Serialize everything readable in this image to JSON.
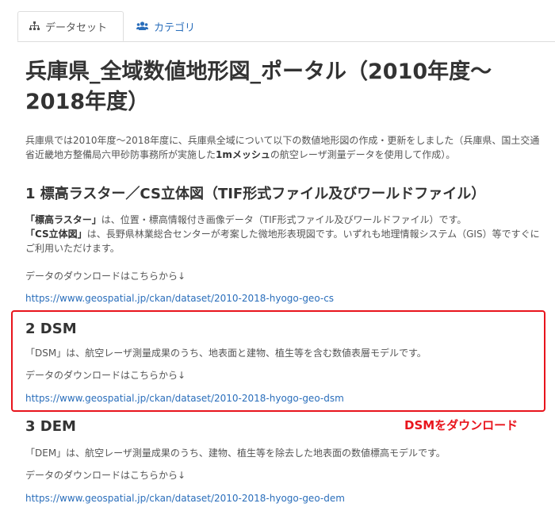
{
  "tabs": {
    "dataset": "データセット",
    "category": "カテゴリ"
  },
  "title": "兵庫県_全域数値地形図_ポータル（2010年度～2018年度）",
  "intro": {
    "text_before": "兵庫県では2010年度～2018年度に、兵庫県全域について以下の数値地形図の作成・更新をしました（兵庫県、国土交通省近畿地方整備局六甲砂防事務所が実施した",
    "bold": "1mメッシュ",
    "text_after": "の航空レーザ測量データを使用して作成）。"
  },
  "section1": {
    "heading": "1 標高ラスター／CS立体図（TIF形式ファイル及びワールドファイル）",
    "line1_bold": "「標高ラスター」",
    "line1_text": "は、位置・標高情報付き画像データ（TIF形式ファイル及びワールドファイル）です。",
    "line2_bold": "「CS立体図」",
    "line2_text": "は、長野県林業総合センターが考案した微地形表現図です。いずれも地理情報システム（GIS）等ですぐにご利用いただけます。",
    "download_text": "データのダウンロードはこちらから↓",
    "link": "https://www.geospatial.jp/ckan/dataset/2010-2018-hyogo-geo-cs"
  },
  "section2": {
    "heading": "2 DSM",
    "description": "「DSM」は、航空レーザ測量成果のうち、地表面と建物、植生等を含む数値表層モデルです。",
    "download_text": "データのダウンロードはこちらから↓",
    "link": "https://www.geospatial.jp/ckan/dataset/2010-2018-hyogo-geo-dsm"
  },
  "annotation": "DSMをダウンロード",
  "section3": {
    "heading": "3 DEM",
    "description": "「DEM」は、航空レーザ測量成果のうち、建物、植生等を除去した地表面の数値標高モデルです。",
    "download_text": "データのダウンロードはこちらから↓",
    "link": "https://www.geospatial.jp/ckan/dataset/2010-2018-hyogo-geo-dem"
  },
  "colors": {
    "link": "#2a6ebb",
    "highlight": "#e8141c"
  },
  "icons": {
    "dataset_tab": "sitemap-icon",
    "category_tab": "users-icon"
  }
}
